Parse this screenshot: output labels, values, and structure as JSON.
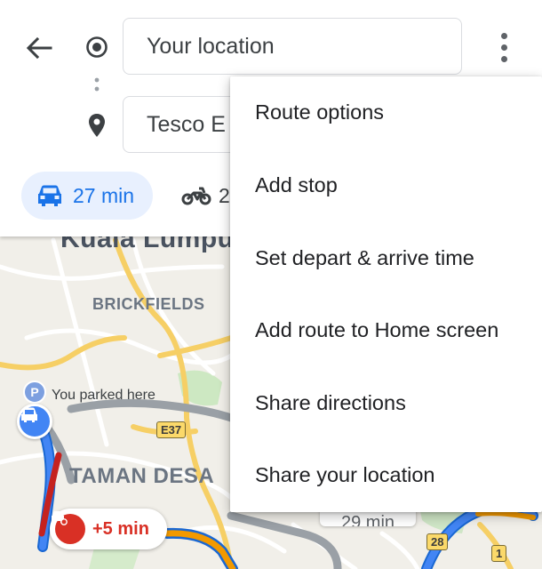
{
  "header": {
    "origin_value": "Your location",
    "destination_value": "Tesco E",
    "modes": [
      {
        "icon": "car-icon",
        "time": "27 min",
        "selected": true
      },
      {
        "icon": "motorcycle-icon",
        "time": "2",
        "selected": false
      }
    ]
  },
  "menu": {
    "items": [
      "Route options",
      "Add stop",
      "Set depart & arrive time",
      "Add route to Home screen",
      "Share directions",
      "Share your location"
    ]
  },
  "map": {
    "labels": {
      "city": "Kuala Lumpu",
      "brickfields": "BRICKFIELDS",
      "taman_desa": "TAMAN DESA",
      "parked": "You parked here",
      "parking_letter": "P"
    },
    "shields": {
      "e37": "E37",
      "r28": "28",
      "r1": "1"
    },
    "delay_chip": "+5 min",
    "alt_route_chip": "29 min"
  },
  "colors": {
    "accent_blue": "#1a73e8",
    "chip_blue_bg": "#e8f0fe",
    "traffic_red": "#d93025",
    "route_blue": "#4285f4",
    "alt_route_gray": "#9aa0a6"
  }
}
